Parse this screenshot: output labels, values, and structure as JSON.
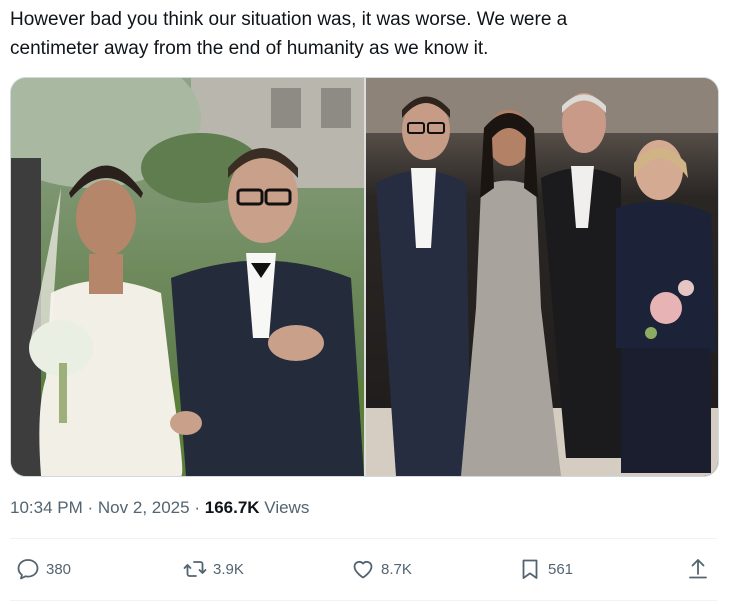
{
  "tweet": {
    "text_line1": "However bad you think our situation was, it was worse. We were a",
    "text_line2": "centimeter away from the end of humanity as we know it."
  },
  "media": [
    {
      "description_icon": "wedding-photo"
    },
    {
      "description_icon": "group-photo"
    }
  ],
  "meta": {
    "time": "10:34 PM",
    "sep1": "·",
    "date": "Nov 2, 2025",
    "sep2": "·",
    "views_count": "166.7K",
    "views_label": "Views"
  },
  "actions": {
    "replies": "380",
    "reposts": "3.9K",
    "likes": "8.7K",
    "bookmarks": "561"
  },
  "colors": {
    "text": "#0f1419",
    "secondary": "#536471",
    "border": "#cfd9de"
  }
}
